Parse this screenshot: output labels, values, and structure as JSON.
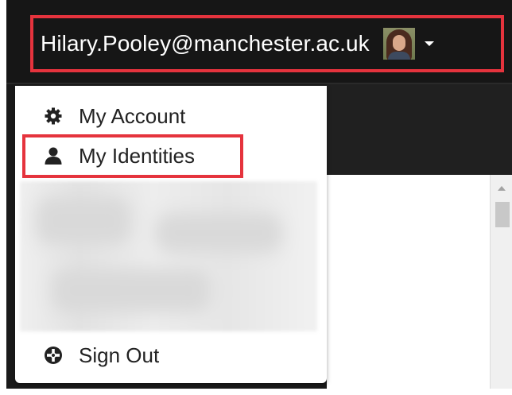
{
  "header": {
    "user_email": "Hilary.Pooley@manchester.ac.uk",
    "avatar_icon": "user-photo",
    "caret_icon": "caret-down-icon",
    "highlight_color": "#e5333d"
  },
  "user_menu": {
    "items": [
      {
        "label": "My Account",
        "icon": "gear-icon"
      },
      {
        "label": "My Identities",
        "icon": "user-icon"
      },
      {
        "label": "Sign Out",
        "icon": "sign-out-icon"
      }
    ]
  }
}
